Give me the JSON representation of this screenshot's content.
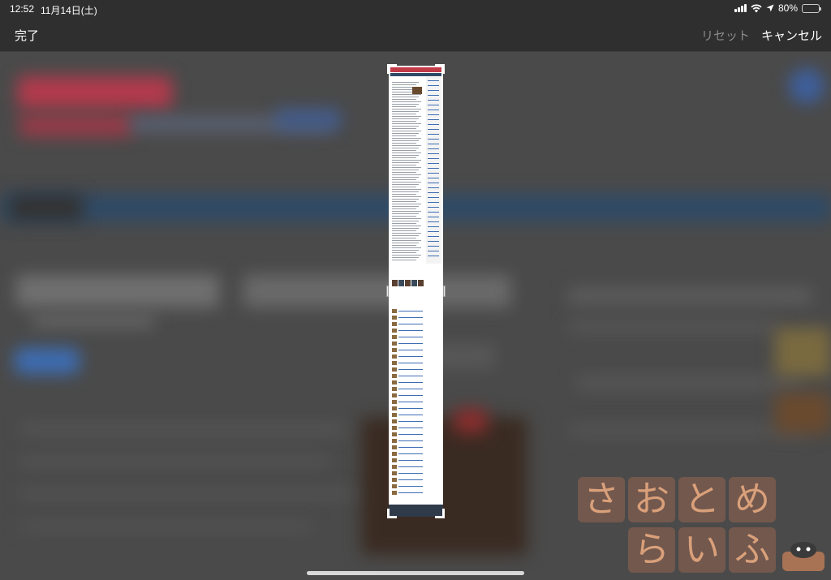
{
  "status_bar": {
    "time": "12:52",
    "date": "11月14日(土)",
    "battery_percent": "80%",
    "battery_level": 0.8,
    "icons": [
      "cellular-signal-icon",
      "wifi-icon",
      "location-arrow-icon",
      "battery-icon"
    ]
  },
  "toolbar": {
    "done_label": "完了",
    "reset_label": "リセット",
    "cancel_label": "キャンセル"
  },
  "watermark": {
    "row1": [
      "さ",
      "お",
      "と",
      "め"
    ],
    "row2": [
      "ら",
      "い",
      "ふ"
    ],
    "mascot": "mascot-icon"
  },
  "colors": {
    "toolbar_bg": "#2f2f2f",
    "reset_disabled": "#8a8a8a",
    "watermark_tile": "#96644f",
    "watermark_text": "#d9a07a"
  }
}
